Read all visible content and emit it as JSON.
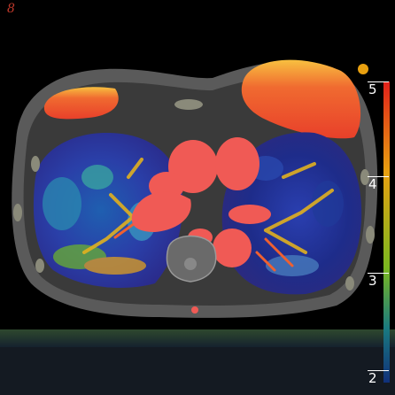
{
  "corner_mark": "8",
  "colorbar": {
    "ticks": [
      "5",
      "4",
      "3",
      "2"
    ],
    "colors": [
      "#e0201a",
      "#e8a010",
      "#7ab820",
      "#1a7a80",
      "#10307a"
    ]
  }
}
